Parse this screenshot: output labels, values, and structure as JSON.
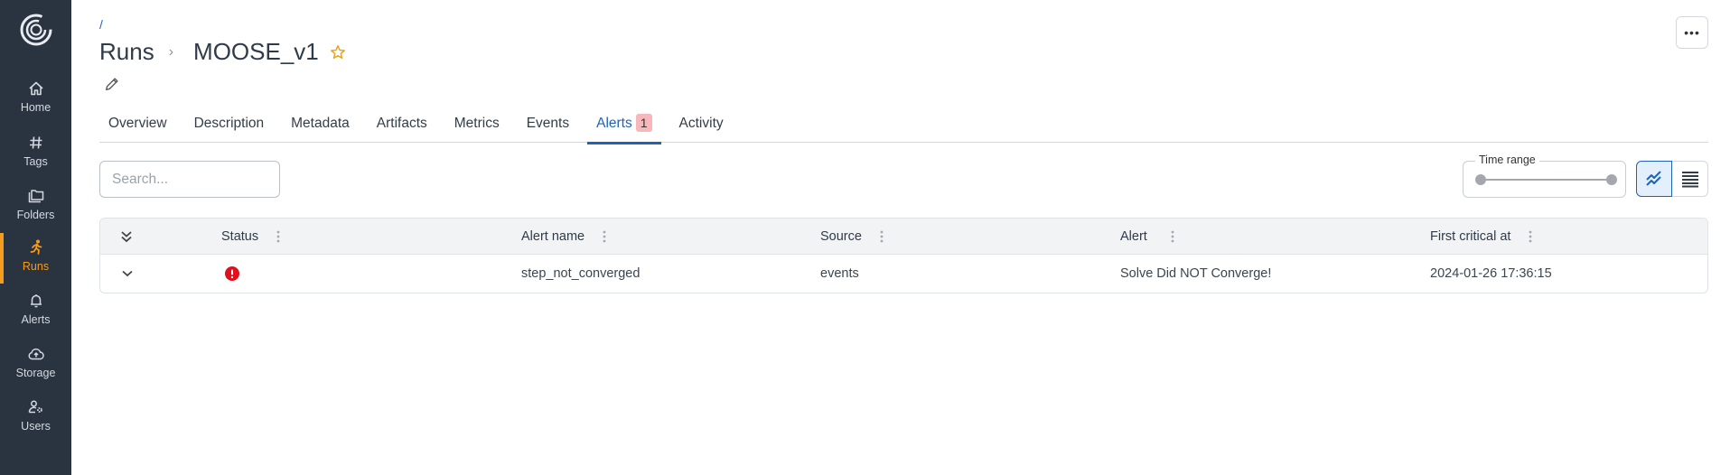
{
  "sidebar": {
    "logo": "app-logo",
    "items": [
      {
        "label": "Home",
        "icon": "home-icon",
        "active": false
      },
      {
        "label": "Tags",
        "icon": "hash-icon",
        "active": false
      },
      {
        "label": "Folders",
        "icon": "folder-icon",
        "active": false
      },
      {
        "label": "Runs",
        "icon": "running-person-icon",
        "active": true
      },
      {
        "label": "Alerts",
        "icon": "bell-icon",
        "active": false
      },
      {
        "label": "Storage",
        "icon": "cloud-upload-icon",
        "active": false
      },
      {
        "label": "Users",
        "icon": "users-settings-icon",
        "active": false
      }
    ]
  },
  "header": {
    "breadcrumb_root": "/",
    "section": "Runs",
    "separator": "›",
    "run_name": "MOOSE_v1",
    "more_label": "•••"
  },
  "tabs": [
    {
      "label": "Overview"
    },
    {
      "label": "Description"
    },
    {
      "label": "Metadata"
    },
    {
      "label": "Artifacts"
    },
    {
      "label": "Metrics"
    },
    {
      "label": "Events"
    },
    {
      "label": "Alerts",
      "badge": "1",
      "active": true
    },
    {
      "label": "Activity"
    }
  ],
  "toolbar": {
    "search_placeholder": "Search...",
    "search_value": "",
    "time_range_label": "Time range",
    "time_range_start": 0,
    "time_range_end": 1
  },
  "table": {
    "columns": [
      "Status",
      "Alert name",
      "Source",
      "Alert",
      "First critical at"
    ],
    "rows": [
      {
        "status": "critical",
        "alert_name": "step_not_converged",
        "source": "events",
        "alert": "Solve Did NOT Converge!",
        "first_critical_at": "2024-01-26 17:36:15"
      }
    ]
  },
  "colors": {
    "accent": "#1e63b8",
    "sidebar_bg": "#2a3340",
    "sidebar_active": "#f39c1e",
    "critical": "#e0101e",
    "star": "#e8a317",
    "badge_bg": "#f7b7bb"
  }
}
